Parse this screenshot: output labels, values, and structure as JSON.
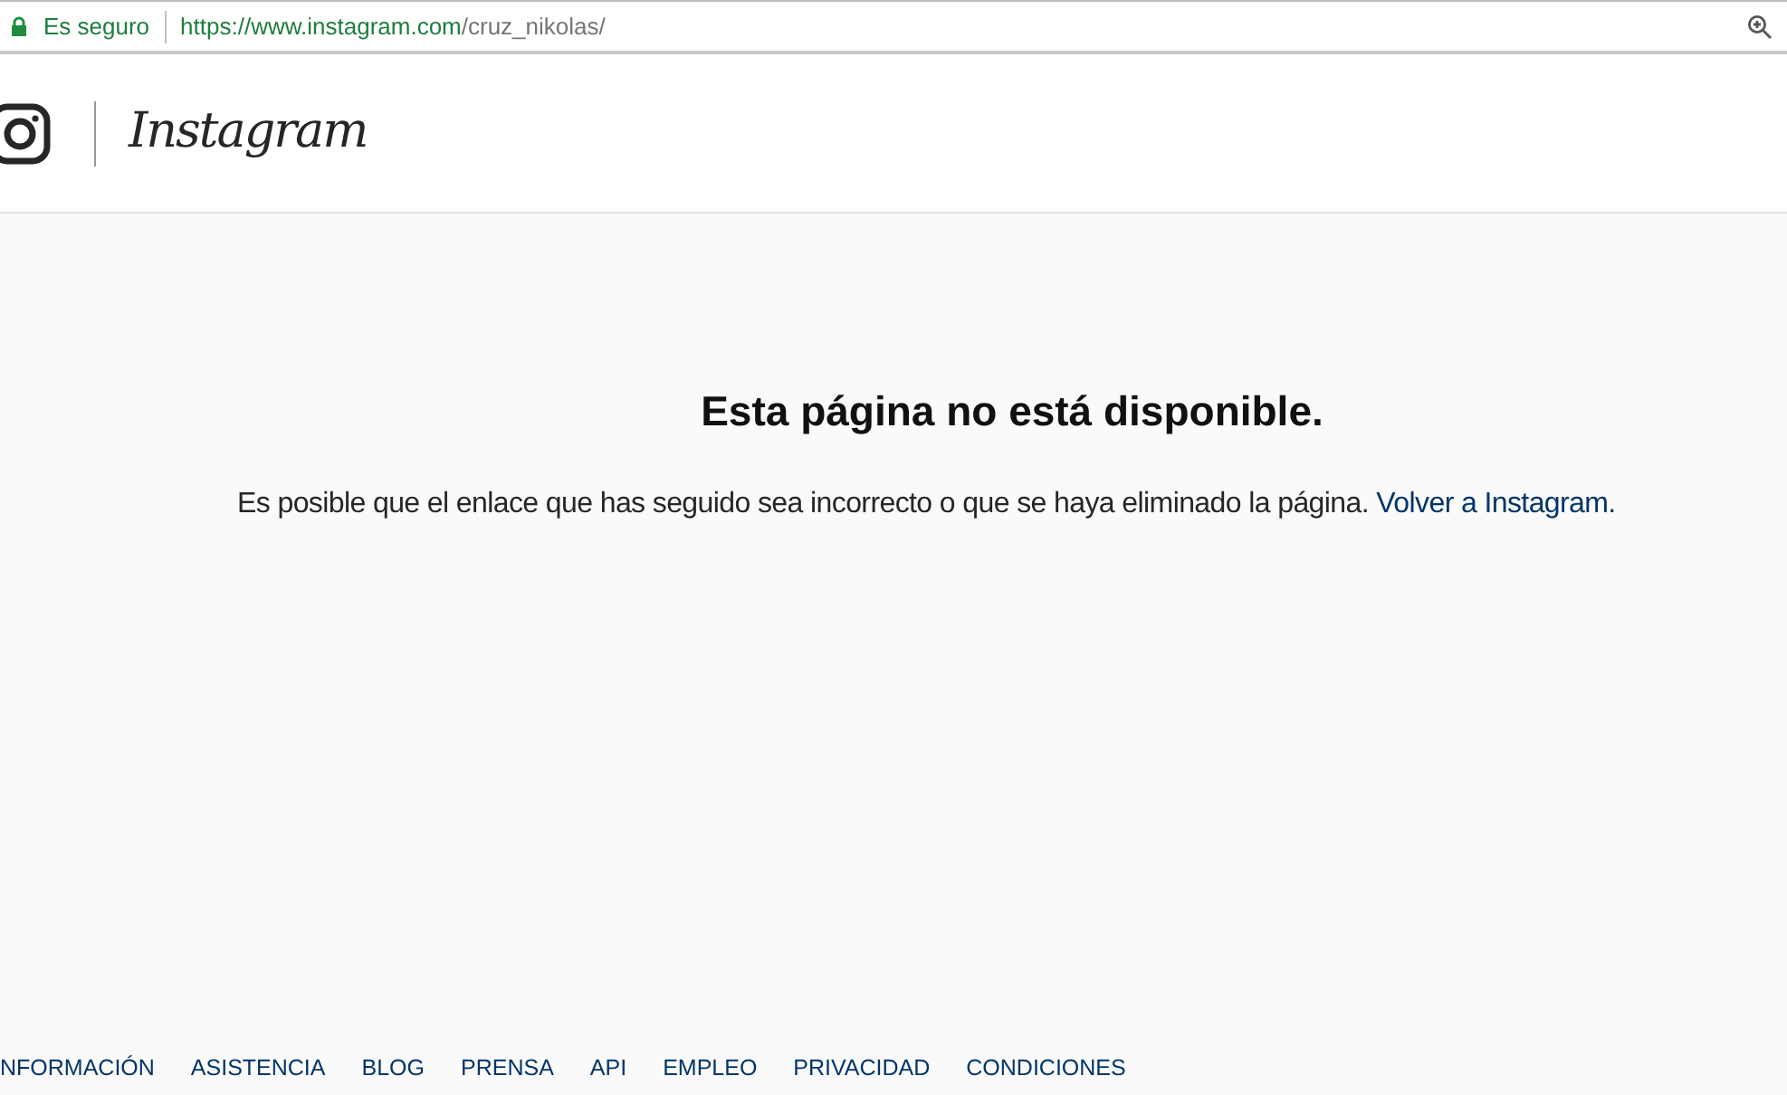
{
  "address_bar": {
    "security_label": "Es seguro",
    "url_base": "https://www.instagram.com",
    "url_path": "/cruz_nikolas/"
  },
  "header": {
    "wordmark": "Instagram"
  },
  "error": {
    "title": "Esta página no está disponible.",
    "message": "Es posible que el enlace que has seguido sea incorrecto o que se haya eliminado la página.",
    "link": "Volver a Instagram."
  },
  "footer": {
    "links": [
      "NFORMACIÓN",
      "ASISTENCIA",
      "BLOG",
      "PRENSA",
      "API",
      "EMPLEO",
      "PRIVACIDAD",
      "CONDICIONES"
    ]
  }
}
